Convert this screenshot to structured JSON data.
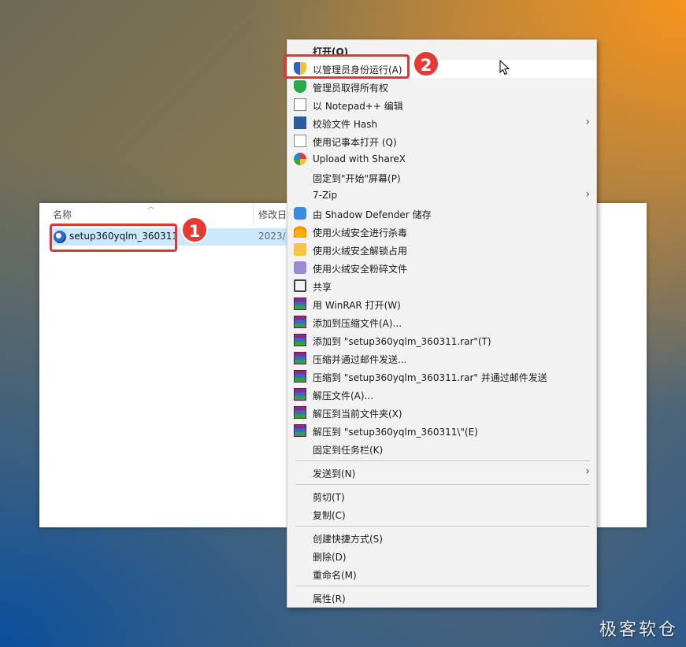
{
  "explorer": {
    "columns": [
      "名称",
      "修改日"
    ],
    "file": {
      "name": "setup360yqlm_360311",
      "date": "2023/"
    }
  },
  "badges": [
    "1",
    "2"
  ],
  "menu": {
    "items": [
      {
        "label": "打开(O)",
        "bold": true
      },
      {
        "label": "以管理员身份运行(A)",
        "icon": "uac-shield-icon",
        "hover": true
      },
      {
        "label": "管理员取得所有权",
        "icon": "green-shield-icon"
      },
      {
        "label": "以 Notepad++ 编辑",
        "icon": "notepadpp-icon"
      },
      {
        "label": "校验文件 Hash",
        "icon": "powershell-icon",
        "submenu": true
      },
      {
        "label": "使用记事本打开 (Q)",
        "icon": "notepad-icon"
      },
      {
        "label": "Upload with ShareX",
        "icon": "sharex-icon"
      },
      {
        "label": "固定到\"开始\"屏幕(P)"
      },
      {
        "label": "7-Zip",
        "submenu": true
      },
      {
        "label": "由 Shadow Defender 储存",
        "icon": "shadow-defender-icon"
      },
      {
        "label": "使用火绒安全进行杀毒",
        "icon": "huorong-icon"
      },
      {
        "label": "使用火绒安全解锁占用",
        "icon": "folder-lock-icon"
      },
      {
        "label": "使用火绒安全粉碎文件",
        "icon": "shredder-icon"
      },
      {
        "label": "共享",
        "icon": "share-icon"
      },
      {
        "label": "用 WinRAR 打开(W)",
        "icon": "winrar-icon"
      },
      {
        "label": "添加到压缩文件(A)...",
        "icon": "winrar-icon"
      },
      {
        "label": "添加到 \"setup360yqlm_360311.rar\"(T)",
        "icon": "winrar-icon"
      },
      {
        "label": "压缩并通过邮件发送...",
        "icon": "winrar-icon"
      },
      {
        "label": "压缩到 \"setup360yqlm_360311.rar\" 并通过邮件发送",
        "icon": "winrar-icon"
      },
      {
        "label": "解压文件(A)...",
        "icon": "winrar-icon"
      },
      {
        "label": "解压到当前文件夹(X)",
        "icon": "winrar-icon"
      },
      {
        "label": "解压到 \"setup360yqlm_360311\\\"(E)",
        "icon": "winrar-icon"
      },
      {
        "label": "固定到任务栏(K)"
      },
      {
        "label": "发送到(N)",
        "submenu": true
      },
      {
        "label": "剪切(T)"
      },
      {
        "label": "复制(C)"
      },
      {
        "label": "创建快捷方式(S)"
      },
      {
        "label": "删除(D)"
      },
      {
        "label": "重命名(M)"
      },
      {
        "label": "属性(R)"
      }
    ]
  },
  "watermark": "极客软仓"
}
